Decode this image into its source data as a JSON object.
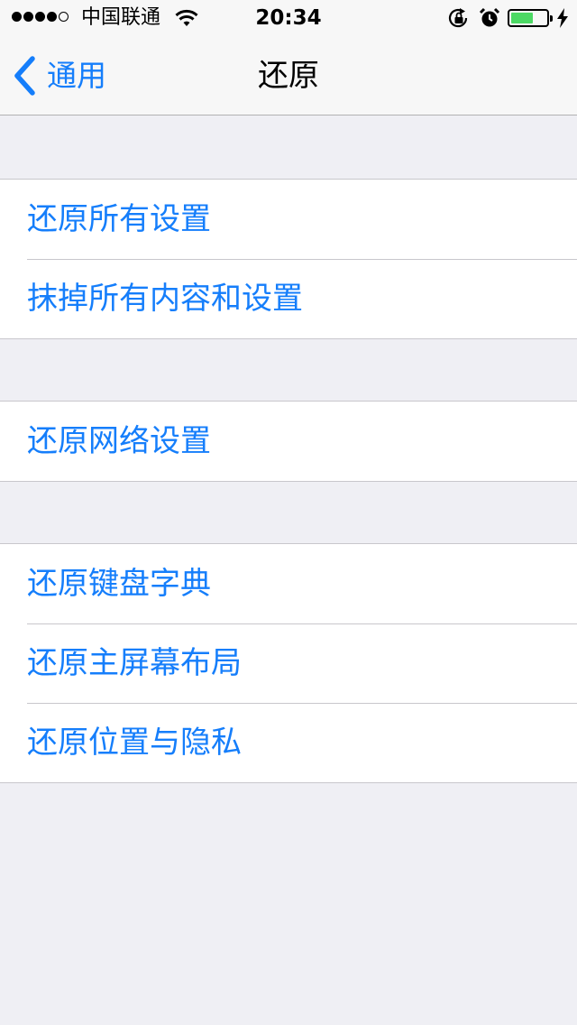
{
  "status_bar": {
    "signal_strength": 4,
    "signal_max": 5,
    "carrier": "中国联通",
    "time": "20:34",
    "battery_level": 0.62,
    "battery_color": "#4cd964",
    "icons": [
      "wifi-icon",
      "rotation-lock-icon",
      "alarm-icon",
      "battery-icon",
      "charging-bolt-icon"
    ]
  },
  "nav": {
    "back_label": "通用",
    "title": "还原",
    "tint_color": "#157efb"
  },
  "groups": [
    {
      "items": [
        {
          "label": "还原所有设置"
        },
        {
          "label": "抹掉所有内容和设置"
        }
      ]
    },
    {
      "items": [
        {
          "label": "还原网络设置"
        }
      ]
    },
    {
      "items": [
        {
          "label": "还原键盘字典"
        },
        {
          "label": "还原主屏幕布局"
        },
        {
          "label": "还原位置与隐私"
        }
      ]
    }
  ]
}
